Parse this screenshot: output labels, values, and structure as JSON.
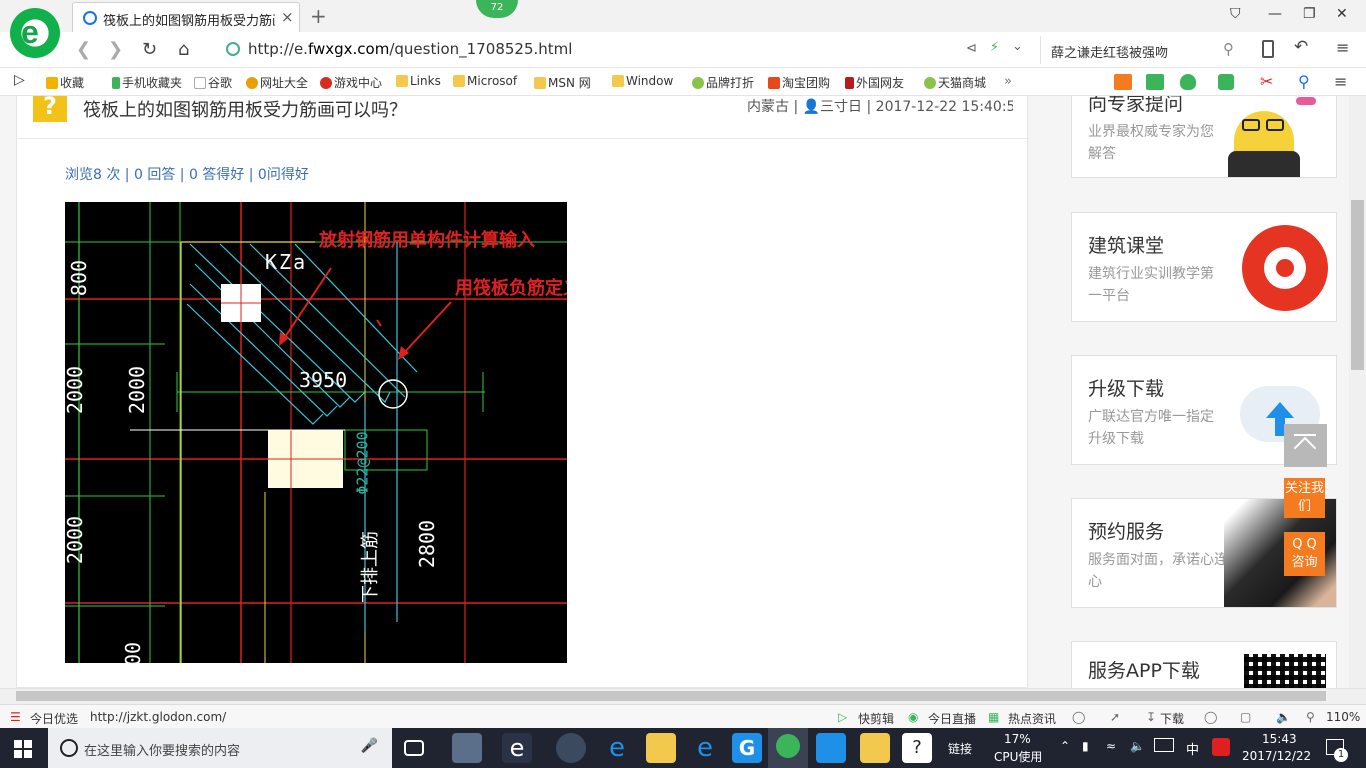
{
  "browser": {
    "tab_title": "筏板上的如图钢筋用板受力筋画可以吗？",
    "tab_close": "×",
    "new_tab": "+",
    "notification_count": "72",
    "url_prefix": "http://e.",
    "url_host": "fwxgx.com",
    "url_path": "/question_1708525.html",
    "search_text": "薛之谦走红毯被强吻",
    "window_controls": [
      "⛉",
      "—",
      "❐",
      "✕"
    ]
  },
  "bookmarks": [
    {
      "label": "收藏",
      "color": "#f2b200"
    },
    {
      "label": "手机收藏夹",
      "color": "#3cb55a"
    },
    {
      "label": "谷歌",
      "color": "#cccccc"
    },
    {
      "label": "网址大全",
      "color": "#e8a000"
    },
    {
      "label": "游戏中心",
      "color": "#d62d20"
    },
    {
      "label": "Links",
      "color": "#f2c94c"
    },
    {
      "label": "Microsof",
      "color": "#f2c94c"
    },
    {
      "label": "MSN 网",
      "color": "#f2c94c"
    },
    {
      "label": "Window",
      "color": "#f2c94c"
    },
    {
      "label": "品牌打折",
      "color": "#8bc34a"
    },
    {
      "label": "淘宝团购",
      "color": "#e64a19"
    },
    {
      "label": "外国网友",
      "color": "#b71c1c"
    },
    {
      "label": "天猫商城",
      "color": "#8bc34a"
    }
  ],
  "question": {
    "icon": "?",
    "title": "筏板上的如图钢筋用板受力筋画可以吗？",
    "meta": "内蒙古 | 👤三寸日 | 2017-12-22 15:40:5",
    "stats": "浏览8 次 | 0 回答 | 0 答得好 | 0问得好"
  },
  "cad": {
    "annotation_1": "放射钢筋用单构件计算输入",
    "annotation_2": "用筏板负筋定义,直线绘制。",
    "label_kza": "KZa",
    "dim_3950": "3950",
    "dim_2000_a": "2000",
    "dim_2000_b": "2000",
    "dim_2000_c": "2000",
    "dim_2800": "2800",
    "rebar_spec": "Φ22@200",
    "rebar_text": "下排上筋",
    "dim_800": "800",
    "dim_00": "00"
  },
  "sidebar": {
    "cards": [
      {
        "title": "向专家提问",
        "desc": "业界最权威专家为您解答"
      },
      {
        "title": "建筑课堂",
        "desc": "建筑行业实训教学第一平台"
      },
      {
        "title": "升级下载",
        "desc": "广联达官方唯一指定升级下载"
      },
      {
        "title": "预约服务",
        "desc": "服务面对面，承诺心连心"
      },
      {
        "title": "服务APP下载",
        "desc": ""
      }
    ],
    "follow_us": "关注我们",
    "qq_consult": "Q Q 咨询"
  },
  "statusbar": {
    "left_label": "今日优选",
    "link_url": "http://jzkt.glodon.com/",
    "items": [
      "快剪辑",
      "今日直播",
      "热点资讯"
    ],
    "download": "下载",
    "zoom": "110%"
  },
  "taskbar": {
    "search_placeholder": "在这里输入你要搜索的内容",
    "link_label": "链接",
    "cpu_percent": "17%",
    "cpu_label": "CPU使用",
    "ime": "中",
    "time": "15:43",
    "date": "2017/12/22",
    "notif_count": "1"
  },
  "colors": {
    "accent_green": "#3cb55a",
    "link_blue": "#3a6fb5",
    "cad_red": "#e02020",
    "orange": "#f47b20"
  }
}
